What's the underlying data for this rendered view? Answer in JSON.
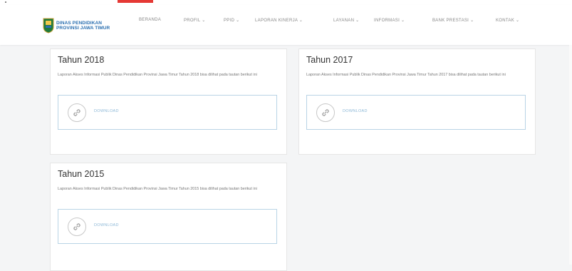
{
  "site": {
    "logo_line1": "DINAS PENDIDIKAN",
    "logo_line2": "PROVINSI JAWA TIMUR",
    "icon": "emblem-logo"
  },
  "nav": {
    "items": [
      {
        "label": "BERANDA"
      },
      {
        "label": "PROFIL ⌄"
      },
      {
        "label": "PPID ⌄"
      },
      {
        "label": "LAPORAN KINERJA ⌄"
      },
      {
        "label": "LAYANAN ⌄"
      },
      {
        "label": "INFORMASI ⌄"
      },
      {
        "label": "BANK PRESTASI ⌄"
      },
      {
        "label": "KONTAK ⌄"
      }
    ]
  },
  "cards": [
    {
      "title": "Tahun 2018",
      "desc": "Laporan Akses Informasi Publik Dinas Pendidikan Provinsi Jawa Timur Tahun 2018 bisa dilihat pada tautan berikut ini",
      "download_label": "DOWNLOAD",
      "icon": "link-icon"
    },
    {
      "title": "Tahun 2017",
      "desc": "Laporan Akses Informasi Publik Dinas Pendidikan Provinsi Jawa Timur Tahun 2017 bisa dilihat pada tautan berikut ini",
      "download_label": "DOWNLOAD",
      "icon": "link-icon"
    },
    {
      "title": "Tahun 2015",
      "desc": "Laporan Akses Informasi Publik Dinas Pendidikan Provinsi Jawa Timur Tahun 2015 bisa dilihat pada tautan berikut ini",
      "download_label": "DOWNLOAD",
      "icon": "link-icon"
    }
  ],
  "colors": {
    "brand_blue": "#2a6fb0",
    "download_blue": "#8bb7d6",
    "box_border": "#b9d4e6",
    "accent_red": "#e53935"
  }
}
